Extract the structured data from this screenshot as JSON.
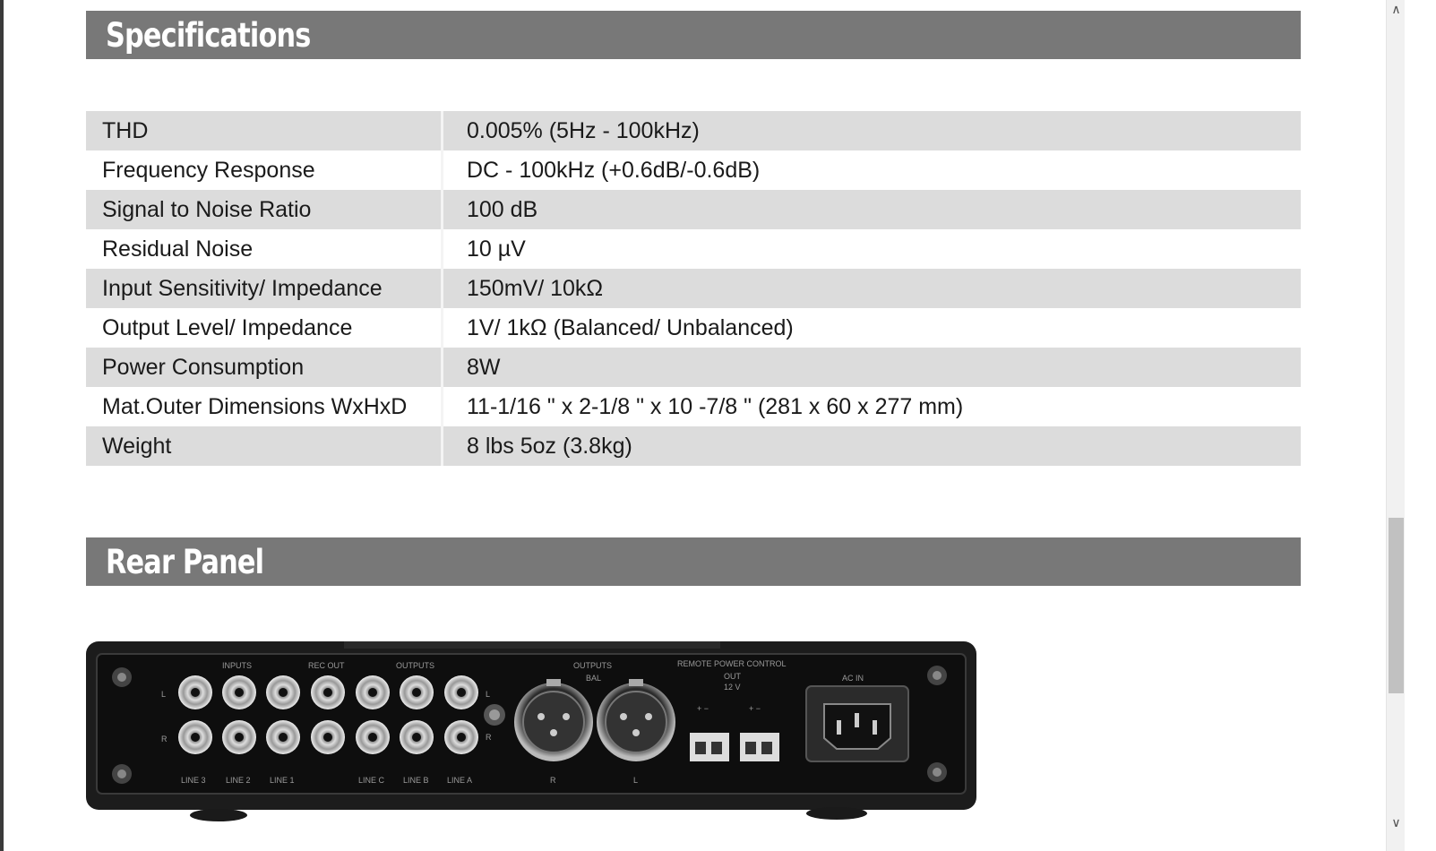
{
  "sections": {
    "specifications": "Specifications",
    "rear_panel": "Rear Panel"
  },
  "specs": [
    {
      "label": "THD",
      "value": "0.005% (5Hz - 100kHz)"
    },
    {
      "label": "Frequency Response",
      "value": "DC - 100kHz (+0.6dB/-0.6dB)"
    },
    {
      "label": "Signal to Noise Ratio",
      "value": "100 dB"
    },
    {
      "label": "Residual Noise",
      "value": "10 µV"
    },
    {
      "label": "Input Sensitivity/ Impedance",
      "value": "150mV/ 10kΩ"
    },
    {
      "label": "Output Level/ Impedance",
      "value": "1V/ 1kΩ (Balanced/ Unbalanced)"
    },
    {
      "label": "Power Consumption",
      "value": "8W"
    },
    {
      "label": "Mat.Outer Dimensions  WxHxD",
      "value": "11-1/16 \" x 2-1/8 \" x 10 -7/8 \" (281 x 60 x 277 mm)"
    },
    {
      "label": "Weight",
      "value": "8 lbs 5oz  (3.8kg)"
    }
  ],
  "rear_panel": {
    "labels": {
      "inputs": "INPUTS",
      "rec_out": "REC OUT",
      "outputs": "OUTPUTS",
      "outputs_bal": "OUTPUTS",
      "bal": "BAL",
      "remote": "REMOTE POWER CONTROL",
      "out": "OUT",
      "volt": "12 V",
      "ac_in": "AC IN",
      "l": "L",
      "r": "R",
      "line3": "LINE 3",
      "line2": "LINE 2",
      "line1": "LINE 1",
      "linec": "LINE C",
      "lineb": "LINE B",
      "linea": "LINE A",
      "xlr_r": "R",
      "xlr_l": "L",
      "plus1": "+ −",
      "plus2": "+ −"
    }
  },
  "scrollbar": {
    "up_icon": "∧",
    "down_icon": "∨"
  }
}
